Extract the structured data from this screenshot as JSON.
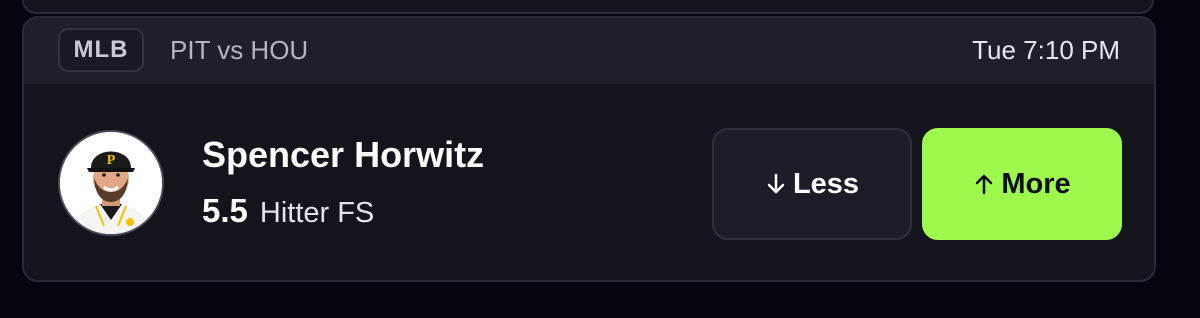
{
  "header": {
    "league": "MLB",
    "matchup": "PIT vs HOU",
    "game_time": "Tue 7:10 PM"
  },
  "player": {
    "name": "Spencer Horwitz",
    "line_value": "5.5",
    "stat_type": "Hitter FS",
    "avatar_icon": "player-headshot"
  },
  "actions": {
    "less_label": "Less",
    "less_icon": "arrow-down-icon",
    "more_label": "More",
    "more_icon": "arrow-up-icon"
  },
  "colors": {
    "page_background": "#05060d",
    "card_background": "#14141d",
    "header_background": "#1e1f29",
    "more_button": "#9dfa4c",
    "less_button": "#1c1d27"
  }
}
